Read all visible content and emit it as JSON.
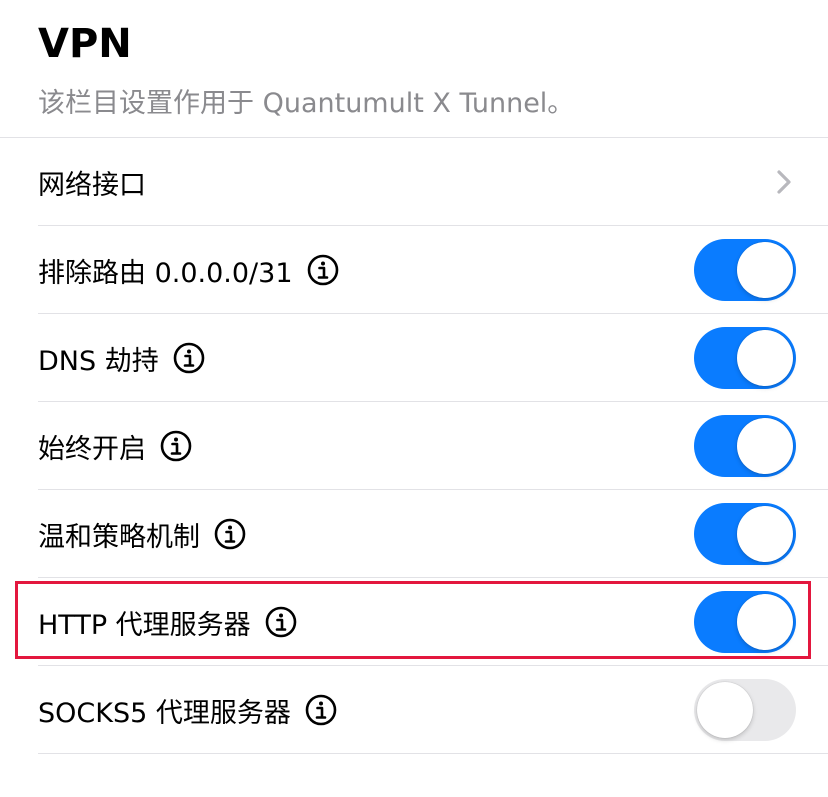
{
  "header": {
    "title": "VPN",
    "subtitle": "该栏目设置作用于 Quantumult X Tunnel。"
  },
  "rows": [
    {
      "label": "网络接口",
      "kind": "chevron"
    },
    {
      "label": "排除路由 0.0.0.0/31",
      "kind": "toggle",
      "on": true,
      "info_icon": "info-icon"
    },
    {
      "label": "DNS 劫持",
      "kind": "toggle",
      "on": true,
      "info_icon": "info-icon"
    },
    {
      "label": "始终开启",
      "kind": "toggle",
      "on": true,
      "info_icon": "info-icon"
    },
    {
      "label": "温和策略机制",
      "kind": "toggle",
      "on": true,
      "info_icon": "info-icon"
    },
    {
      "label": "HTTP 代理服务器",
      "kind": "toggle",
      "on": true,
      "info_icon": "info-icon",
      "highlighted": true
    },
    {
      "label": "SOCKS5 代理服务器",
      "kind": "toggle",
      "on": false,
      "info_icon": "info-icon"
    }
  ],
  "icons": {
    "chevron": "chevron-right-icon",
    "info": "info-icon"
  },
  "colors": {
    "toggle_on": "#0a7cff",
    "toggle_off": "#e9e9eb",
    "subtitle": "#8a8a8e",
    "divider": "#e2e2e6",
    "highlight": "#e3173e"
  }
}
